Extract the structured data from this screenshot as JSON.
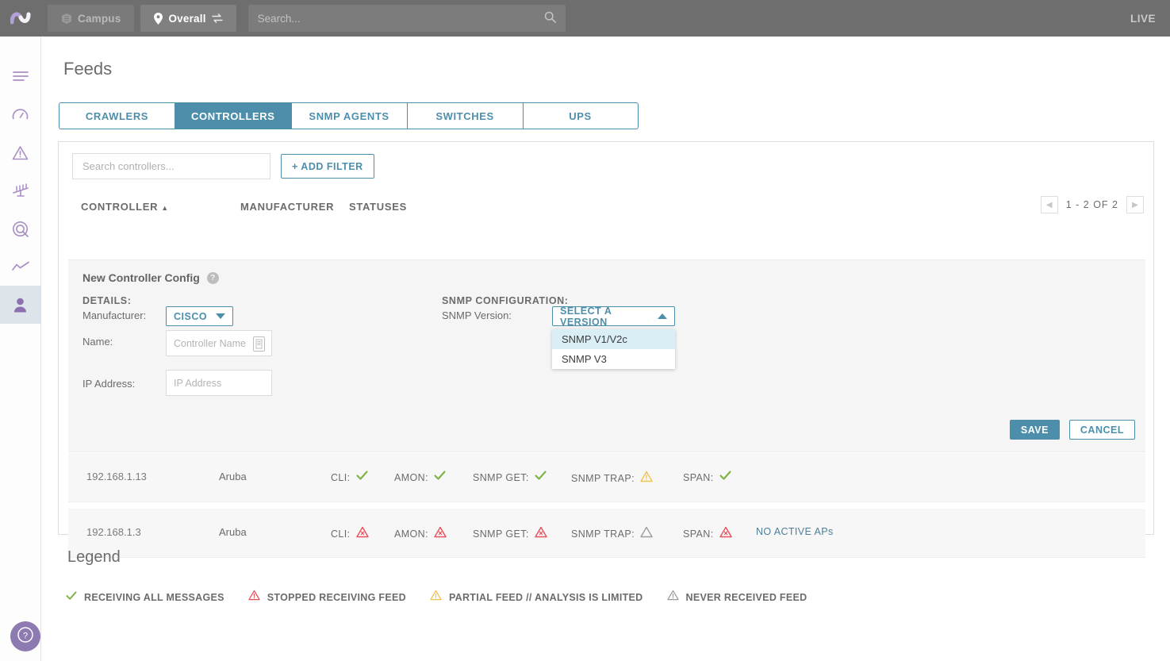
{
  "topbar": {
    "logo": "wave-logo",
    "campus_chip": {
      "label": "Campus",
      "icon": "cube-icon"
    },
    "overall_chip": {
      "label": "Overall",
      "icon": "pin-icon",
      "swap_icon": "swap-icon"
    },
    "search": {
      "placeholder": "Search...",
      "value": "",
      "icon": "search-icon"
    },
    "live_label": "LIVE"
  },
  "sidebar": {
    "items": [
      {
        "name": "menu",
        "icon": "hamburger-icon",
        "active": false
      },
      {
        "name": "dashboard",
        "icon": "gauge-icon",
        "active": false
      },
      {
        "name": "alerts",
        "icon": "warning-triangle-icon",
        "active": false
      },
      {
        "name": "balance",
        "icon": "scale-icon",
        "active": false
      },
      {
        "name": "radar",
        "icon": "target-icon",
        "active": false
      },
      {
        "name": "trends",
        "icon": "line-chart-icon",
        "active": false
      },
      {
        "name": "clients",
        "icon": "person-icon",
        "active": true
      }
    ],
    "help": {
      "icon": "question-circle-icon"
    }
  },
  "page": {
    "title": "Feeds"
  },
  "tabs": [
    {
      "label": "CRAWLERS",
      "active": false
    },
    {
      "label": "CONTROLLERS",
      "active": true
    },
    {
      "label": "SNMP AGENTS",
      "active": false
    },
    {
      "label": "SWITCHES",
      "active": false
    },
    {
      "label": "UPS",
      "active": false
    }
  ],
  "filters": {
    "search": {
      "placeholder": "Search controllers...",
      "value": ""
    },
    "add_filter_label": "+ ADD FILTER"
  },
  "table": {
    "columns": {
      "controller": "CONTROLLER",
      "sort_caret": "▲",
      "manufacturer": "MANUFACTURER",
      "statuses": "STATUSES"
    },
    "pagination": {
      "prev_icon": "chevron-left-icon",
      "next_icon": "chevron-right-icon",
      "range": "1 - 2",
      "of_label": "OF",
      "total": "2"
    },
    "rows": [
      {
        "ip": "192.168.1.13",
        "manufacturer": "Aruba",
        "statuses": [
          {
            "label": "CLI:",
            "state": "ok"
          },
          {
            "label": "AMON:",
            "state": "ok"
          },
          {
            "label": "SNMP GET:",
            "state": "ok"
          },
          {
            "label": "SNMP TRAP:",
            "state": "partial"
          },
          {
            "label": "SPAN:",
            "state": "ok"
          }
        ],
        "note": ""
      },
      {
        "ip": "192.168.1.3",
        "manufacturer": "Aruba",
        "statuses": [
          {
            "label": "CLI:",
            "state": "stopped"
          },
          {
            "label": "AMON:",
            "state": "stopped"
          },
          {
            "label": "SNMP GET:",
            "state": "stopped"
          },
          {
            "label": "SNMP TRAP:",
            "state": "never"
          },
          {
            "label": "SPAN:",
            "state": "stopped"
          }
        ],
        "note": "NO ACTIVE APs"
      }
    ]
  },
  "config_panel": {
    "title": "New Controller Config",
    "help_icon": "question-circle-icon",
    "details_heading": "DETAILS:",
    "manufacturer_label": "Manufacturer:",
    "manufacturer_value": "CISCO",
    "name_label": "Name:",
    "name_placeholder": "Controller Name",
    "name_value": "",
    "name_field_icon": "device-icon",
    "ip_label": "IP Address:",
    "ip_placeholder": "IP Address",
    "ip_value": "",
    "snmp_heading": "SNMP CONFIGURATION:",
    "snmp_version_label": "SNMP Version:",
    "snmp_version_value": "SELECT A VERSION",
    "snmp_options": [
      {
        "label": "SNMP V1/V2c",
        "highlighted": true
      },
      {
        "label": "SNMP V3",
        "highlighted": false
      }
    ],
    "save_label": "SAVE",
    "cancel_label": "CANCEL"
  },
  "legend": {
    "title": "Legend",
    "items": [
      {
        "icon": "check-icon",
        "state": "ok",
        "label": "RECEIVING ALL MESSAGES"
      },
      {
        "icon": "warning-triangle-icon",
        "state": "stopped",
        "label": "STOPPED RECEIVING FEED"
      },
      {
        "icon": "warning-triangle-icon",
        "state": "partial",
        "label": "PARTIAL FEED // ANALYSIS IS LIMITED"
      },
      {
        "icon": "warning-triangle-icon",
        "state": "never",
        "label": "NEVER RECEIVED FEED"
      }
    ]
  },
  "colors": {
    "accent": "#4d8fab",
    "topbar": "#6e6e6e",
    "purple": "#8d7ab0",
    "ok": "#7cb342",
    "stopped": "#e8505b",
    "partial": "#f2c14e",
    "never": "#9e9e9e"
  }
}
